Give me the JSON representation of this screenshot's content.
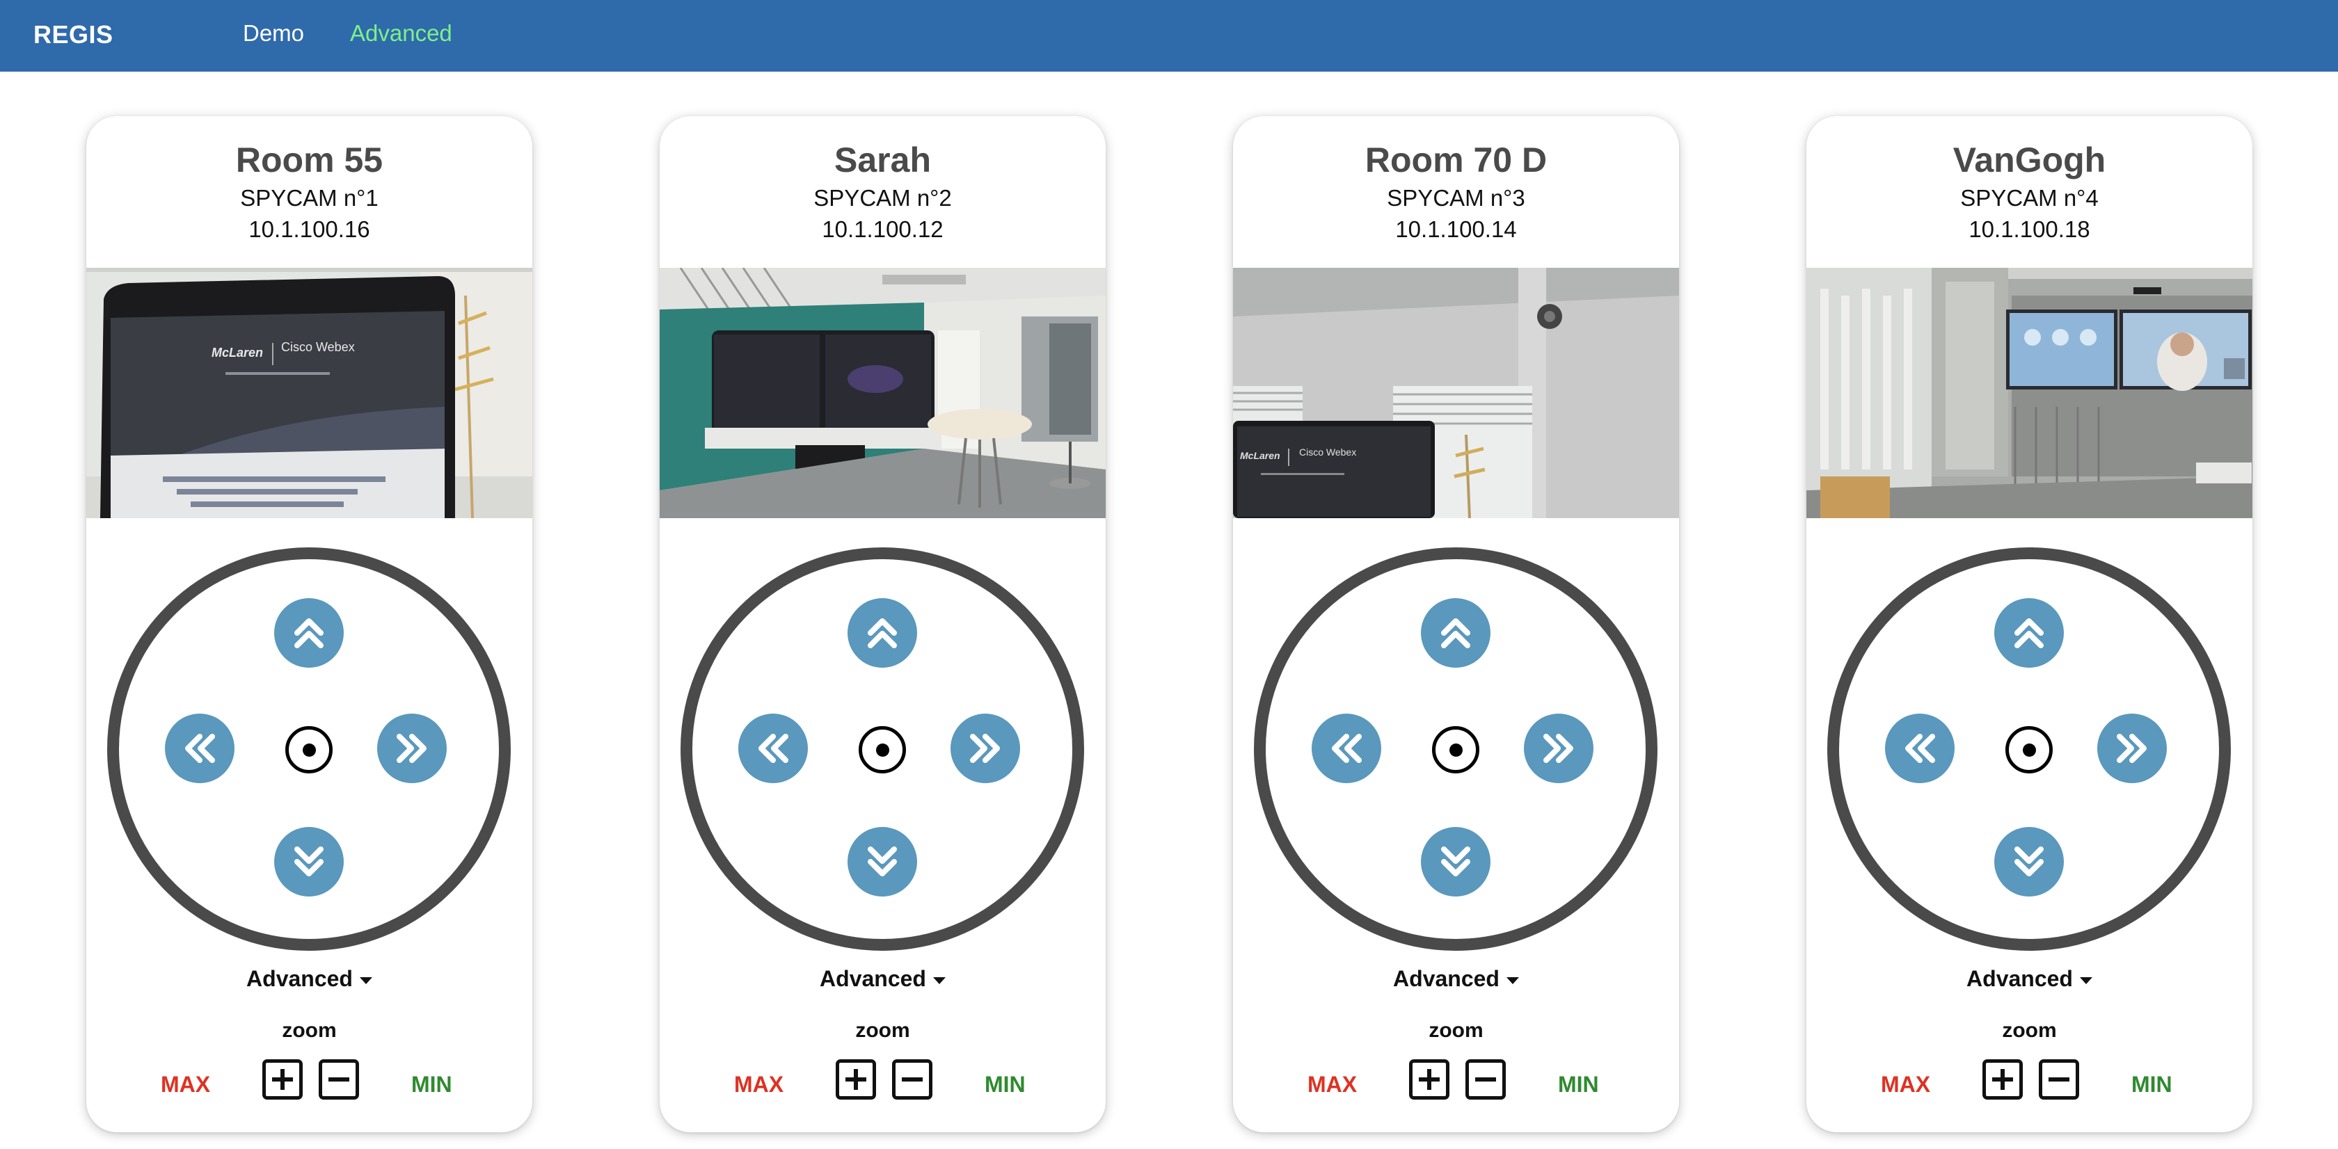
{
  "app": {
    "brand": "REGIS"
  },
  "nav": {
    "demo": "Demo",
    "advanced": "Advanced"
  },
  "cards": [
    {
      "room": "Room 55",
      "cam": "SPYCAM n°1",
      "ip": "10.1.100.16",
      "advanced_label": "Advanced",
      "zoom_label": "zoom",
      "max_label": "MAX",
      "min_label": "MIN"
    },
    {
      "room": "Sarah",
      "cam": "SPYCAM n°2",
      "ip": "10.1.100.12",
      "advanced_label": "Advanced",
      "zoom_label": "zoom",
      "max_label": "MAX",
      "min_label": "MIN"
    },
    {
      "room": "Room 70 D",
      "cam": "SPYCAM n°3",
      "ip": "10.1.100.14",
      "advanced_label": "Advanced",
      "zoom_label": "zoom",
      "max_label": "MAX",
      "min_label": "MIN"
    },
    {
      "room": "VanGogh",
      "cam": "SPYCAM n°4",
      "ip": "10.1.100.18",
      "advanced_label": "Advanced",
      "zoom_label": "zoom",
      "max_label": "MAX",
      "min_label": "MIN"
    }
  ],
  "icons": {
    "up": "chevrons-up-icon",
    "down": "chevrons-down-icon",
    "left": "chevrons-left-icon",
    "right": "chevrons-right-icon",
    "center": "target-icon",
    "plus": "plus-square-icon",
    "minus": "minus-square-icon",
    "caret": "caret-down-icon"
  },
  "colors": {
    "navbar": "#2f6aab",
    "nav_active": "#7ef08a",
    "ptz_button": "#5a98bd",
    "ring": "#4a4a4a",
    "max": "#dd3223",
    "min": "#2f8a2f"
  }
}
